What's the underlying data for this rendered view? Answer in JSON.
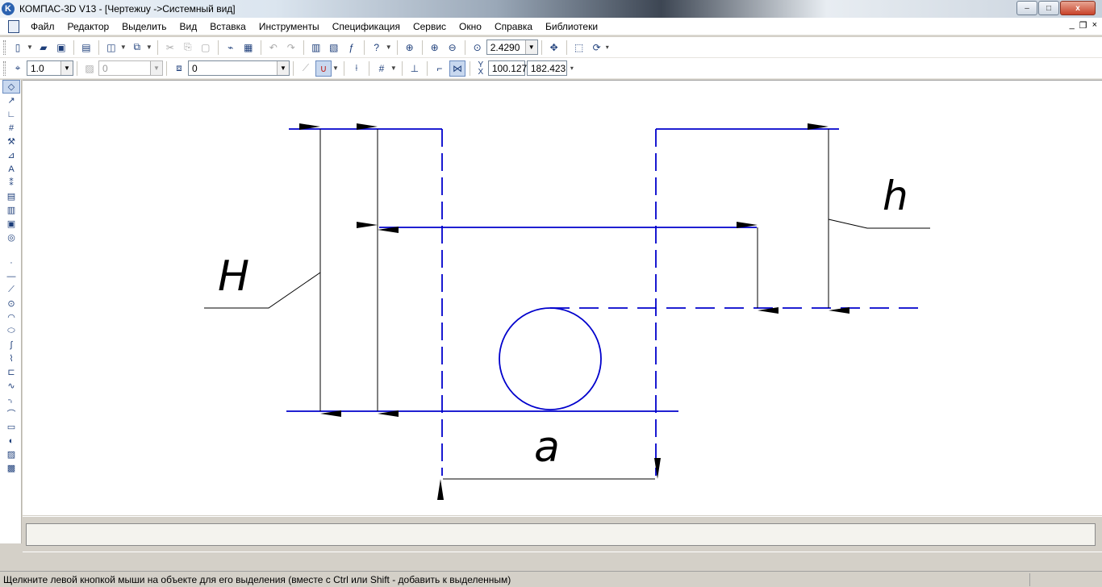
{
  "window": {
    "title": "КОМПАС-3D V13 - [Чертежuy ->Системный вид]",
    "minimize_glyph": "–",
    "maximize_glyph": "□",
    "close_glyph": "x"
  },
  "menu": {
    "items": [
      "Файл",
      "Редактор",
      "Выделить",
      "Вид",
      "Вставка",
      "Инструменты",
      "Спецификация",
      "Сервис",
      "Окно",
      "Справка",
      "Библиотеки"
    ],
    "mdi_minimize": "_",
    "mdi_restore": "❐",
    "mdi_close": "×"
  },
  "toolbar_standard": {
    "zoom_value": "2.4290"
  },
  "toolbar_current_state": {
    "step_value": "1.0",
    "layer_disabled_value": "0",
    "layer_value": "0",
    "coord_x": "100.127",
    "coord_y": "182.423"
  },
  "drawing": {
    "labels": {
      "H": "H",
      "h": "h",
      "a": "a"
    }
  },
  "status": {
    "text": "Щелкните левой кнопкой мыши на объекте для его выделения (вместе с Ctrl или Shift - добавить к выделенным)"
  },
  "colors": {
    "geometry": "#0000cc",
    "dimension": "#000000",
    "canvas": "#ffffff"
  }
}
